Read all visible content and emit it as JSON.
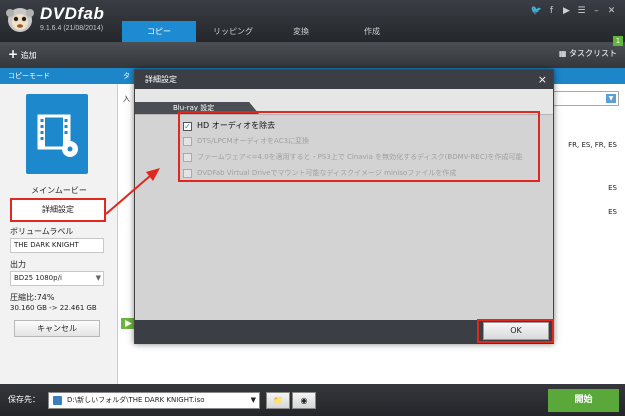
{
  "app": {
    "brand": "DVDfab",
    "version": "9.1.6.4 (21/08/2014)"
  },
  "tabs": [
    "コピー",
    "リッピング",
    "変換",
    "作成"
  ],
  "window_icons": [
    "twitter-icon",
    "facebook-icon",
    "youtube-icon",
    "settings-icon",
    "minimize-icon",
    "close-icon"
  ],
  "toolbar": {
    "add_label": "追加",
    "tasklist_label": "タスクリスト",
    "task_badge": "1"
  },
  "left": {
    "header": "コピーモード",
    "main_movie": "メインムービー",
    "settings_button": "詳細設定",
    "volume_label_title": "ボリュームラベル",
    "volume_label_value": "THE DARK KNIGHT",
    "output_title": "出力",
    "output_value": "BD25 1080p/i",
    "compression": "圧縮比:74%",
    "size_info": "30.160 GB -> 22.461 GB",
    "cancel_button": "キャンセル"
  },
  "right_bg": {
    "header_fragment": "タ",
    "row_fragment": "入",
    "lang_rows": [
      "FR, ES, FR, ES",
      "ES",
      "ES"
    ]
  },
  "dialog": {
    "title": "詳細設定",
    "close": "×",
    "section_tab": "Blu-ray 設定",
    "options": [
      {
        "label": "HD オーディオを除去",
        "checked": true,
        "enabled": true
      },
      {
        "label": "DTS/LPCMオーディオをAC3に変換",
        "checked": false,
        "enabled": false
      },
      {
        "label": "ファームウェア<=4.0を適用すると・PS3上で Cinavia を無効化するディスク(BDMV-REC)を作成可能",
        "checked": false,
        "enabled": false
      },
      {
        "label": "DVDFab Virtual Driveでマウント可能なディスクイメージ minisoファイルを作成",
        "checked": false,
        "enabled": false
      }
    ],
    "ok_button": "OK"
  },
  "bottom": {
    "save_label": "保存先：",
    "save_path": "D:\\新しいフォルダ\\THE DARK KNIGHT.iso",
    "start_button": "開始"
  },
  "colors": {
    "accent": "#1c86c9",
    "highlight": "#e0281e",
    "start": "#5aa83a"
  }
}
